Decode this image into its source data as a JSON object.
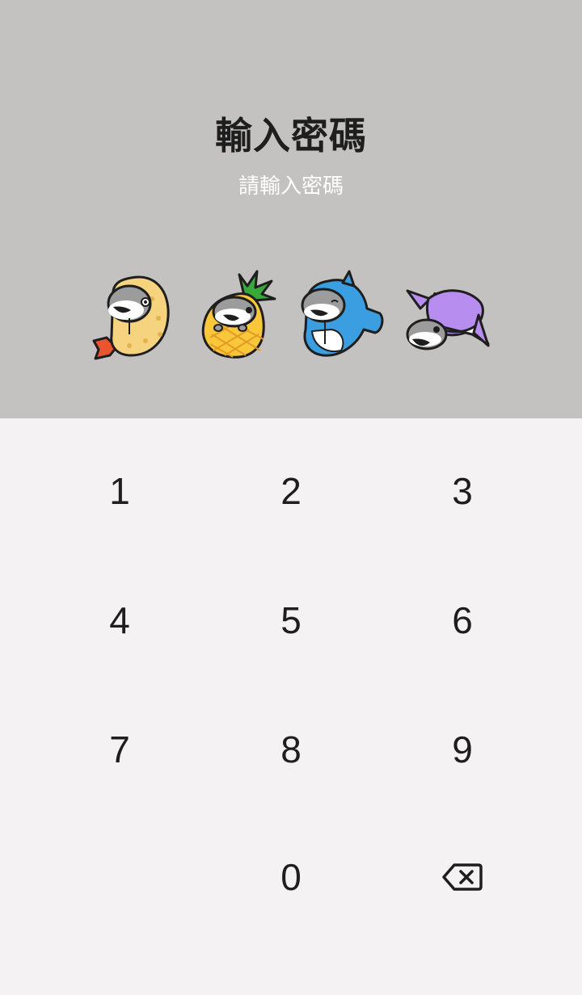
{
  "header": {
    "title": "輸入密碼",
    "subtitle": "請輸入密碼",
    "bg_color": "#c3c2c0"
  },
  "pin_indicators": [
    {
      "name": "fried-shrimp-character-icon",
      "color": "#f6d37e"
    },
    {
      "name": "pineapple-character-icon",
      "color": "#f9c83a"
    },
    {
      "name": "shark-character-icon",
      "color": "#3a9ee0"
    },
    {
      "name": "purple-fish-character-icon",
      "color": "#b78df0"
    }
  ],
  "keypad": {
    "keys": [
      "1",
      "2",
      "3",
      "4",
      "5",
      "6",
      "7",
      "8",
      "9",
      "0"
    ],
    "backspace_icon": "backspace-icon"
  }
}
